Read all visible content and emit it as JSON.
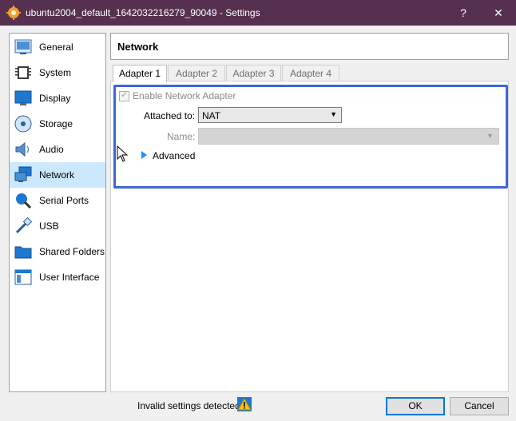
{
  "window": {
    "title": "ubuntu2004_default_1642032216279_90049 - Settings",
    "help_glyph": "?",
    "close_glyph": "✕"
  },
  "sidebar": {
    "items": [
      {
        "label": "General",
        "icon": "general-icon"
      },
      {
        "label": "System",
        "icon": "system-chip-icon"
      },
      {
        "label": "Display",
        "icon": "display-monitor-icon"
      },
      {
        "label": "Storage",
        "icon": "storage-disk-icon"
      },
      {
        "label": "Audio",
        "icon": "speaker-icon"
      },
      {
        "label": "Network",
        "icon": "network-icon",
        "active": true
      },
      {
        "label": "Serial Ports",
        "icon": "serial-port-icon"
      },
      {
        "label": "USB",
        "icon": "usb-icon"
      },
      {
        "label": "Shared Folders",
        "icon": "folder-icon"
      },
      {
        "label": "User Interface",
        "icon": "user-interface-icon"
      }
    ]
  },
  "header": {
    "title": "Network"
  },
  "tabs": [
    {
      "label": "Adapter 1",
      "active": true
    },
    {
      "label": "Adapter 2"
    },
    {
      "label": "Adapter 3"
    },
    {
      "label": "Adapter 4"
    }
  ],
  "adapter": {
    "enable_label": "Enable Network Adapter",
    "enabled": true,
    "attached_label": "Attached to:",
    "attached_value": "NAT",
    "name_label": "Name:",
    "name_value": "",
    "advanced_label": "Advanced"
  },
  "footer": {
    "status": "Invalid settings detected",
    "ok": "OK",
    "cancel": "Cancel"
  },
  "colors": {
    "titlebar": "#55304f",
    "selection": "#cce8ff",
    "highlight_border": "#3c66d6",
    "ok_border": "#0078d7"
  }
}
